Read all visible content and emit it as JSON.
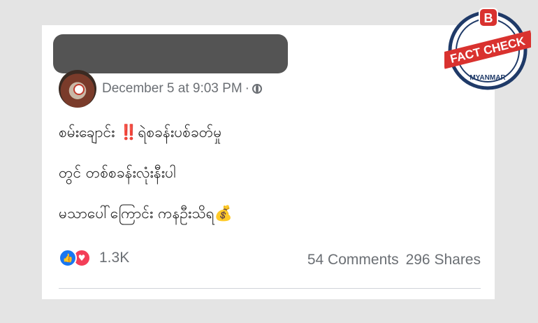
{
  "post": {
    "timestamp": "December 5 at 9:03 PM",
    "separator": "·",
    "line1_prefix": "စမ်းချောင်း ",
    "line1_bang": "‼️",
    "line1_suffix": "ရဲစခန်းပစ်ခတ်မှု",
    "line2": "တွင် တစ်စခန်းလုံးနီးပါ",
    "line3": "မသာပေါ်ကြောင်း ကနဦးသိရ",
    "line3_emoji": "💰",
    "reactions_count": "1.3K",
    "comments": "54 Comments",
    "shares": "296 Shares"
  },
  "badge": {
    "letter": "B",
    "label": "FACT CHECK",
    "sub": "MYANMAR",
    "colors": {
      "red": "#d9322f",
      "navy": "#1f3a68"
    }
  }
}
